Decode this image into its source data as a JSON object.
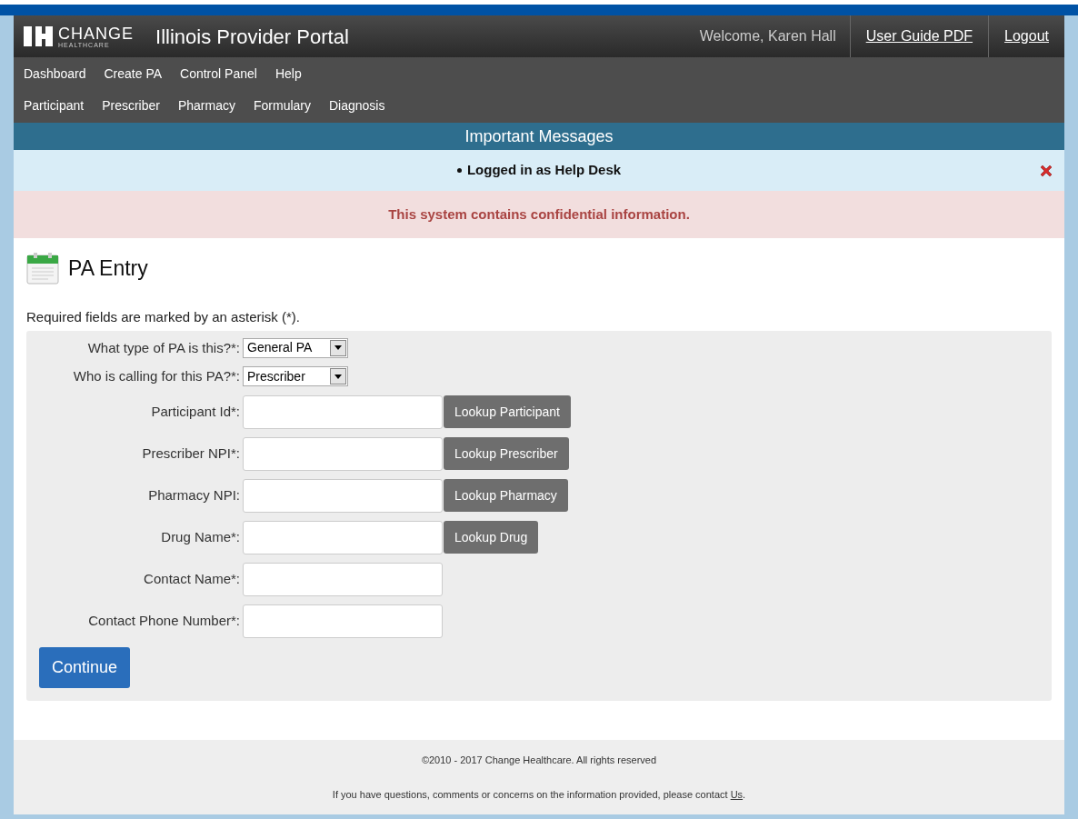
{
  "header": {
    "logo": {
      "name": "CHANGE",
      "tagline": "HEALTHCARE"
    },
    "title": "Illinois Provider Portal",
    "welcome": "Welcome, Karen Hall",
    "links": [
      "User Guide PDF",
      "Logout"
    ]
  },
  "nav": {
    "rows": [
      [
        "Dashboard",
        "Create PA",
        "Control Panel",
        "Help"
      ],
      [
        "Participant",
        "Prescriber",
        "Pharmacy",
        "Formulary",
        "Diagnosis"
      ]
    ]
  },
  "messages": {
    "title": "Important Messages",
    "items": [
      "Logged in as Help Desk"
    ],
    "alert": "This system contains confidential information."
  },
  "page": {
    "title": "PA Entry",
    "note": "Required fields are marked by an asterisk (*)."
  },
  "form": {
    "fields": [
      {
        "kind": "select",
        "label": "What type of PA is this?*:",
        "value": "General PA"
      },
      {
        "kind": "select",
        "label": "Who is calling for this PA?*:",
        "value": "Prescriber"
      },
      {
        "kind": "input",
        "label": "Participant Id*:",
        "button": "Lookup Participant"
      },
      {
        "kind": "input",
        "label": "Prescriber NPI*:",
        "button": "Lookup Prescriber"
      },
      {
        "kind": "input",
        "label": "Pharmacy NPI:",
        "button": "Lookup Pharmacy"
      },
      {
        "kind": "input",
        "label": "Drug Name*:",
        "button": "Lookup Drug"
      },
      {
        "kind": "input",
        "label": "Contact Name*:"
      },
      {
        "kind": "input",
        "label": "Contact Phone Number*:"
      }
    ],
    "submit": "Continue"
  },
  "footer": {
    "copyright": "©2010 - 2017 Change Healthcare. All rights reserved",
    "contact": {
      "before": "If you have questions, comments or concerns on the information provided, please contact ",
      "link": "Us",
      "after": "."
    }
  }
}
